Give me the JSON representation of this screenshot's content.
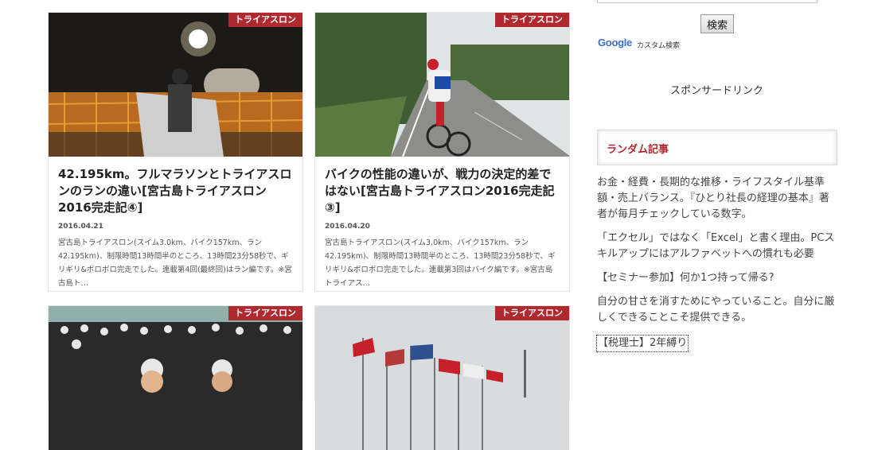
{
  "posts": [
    {
      "category": "トライアスロン",
      "title": "42.195km。フルマラソンとトライアスロンのランの違い[宮古島トライアスロン2016完走記④]",
      "date": "2016.04.21",
      "excerpt": "宮古島トライアスロン(スイム3.0km、バイク157km、ラン42.195km)、制限時間13時間半のところ、13時間23分58秒で、ギリギリ&ボロボロ完走でした。連載第4回(最終回)はラン編です。※宮古島ト…"
    },
    {
      "category": "トライアスロン",
      "title": "バイクの性能の違いが、戦力の決定的差ではない[宮古島トライアスロン2016完走記③]",
      "date": "2016.04.20",
      "excerpt": "宮古島トライアスロン(スイム3.0km、バイク157km、ラン42.195km)、制限時間13時間半のところ、13時間23分58秒で、ギリギリ&ボロボロ完走でした。連載第3回はバイク編です。※宮古島トライアス…"
    },
    {
      "category": "トライアスロン"
    },
    {
      "category": "トライアスロン"
    }
  ],
  "sidebar": {
    "search_button": "検索",
    "google_logo": "Google",
    "custom_search": "カスタム検索",
    "sponsor": "スポンサードリンク",
    "random_heading": "ランダム記事",
    "random_items": [
      "お金・経費・長期的な推移・ライフスタイル基準額・売上バランス。『ひとり社長の経理の基本』著者が毎月チェックしている数字。",
      "「エクセル」ではなく「Excel」と書く理由。PCスキルアップにはアルファベットへの慣れも必要",
      "【セミナー参加】何か1つ持って帰る?",
      "自分の甘さを消すためにやっていること。自分に厳しくできることこそ提供できる。",
      "【税理士】2年縛り"
    ]
  },
  "colors": {
    "accent": "#b0292f"
  }
}
